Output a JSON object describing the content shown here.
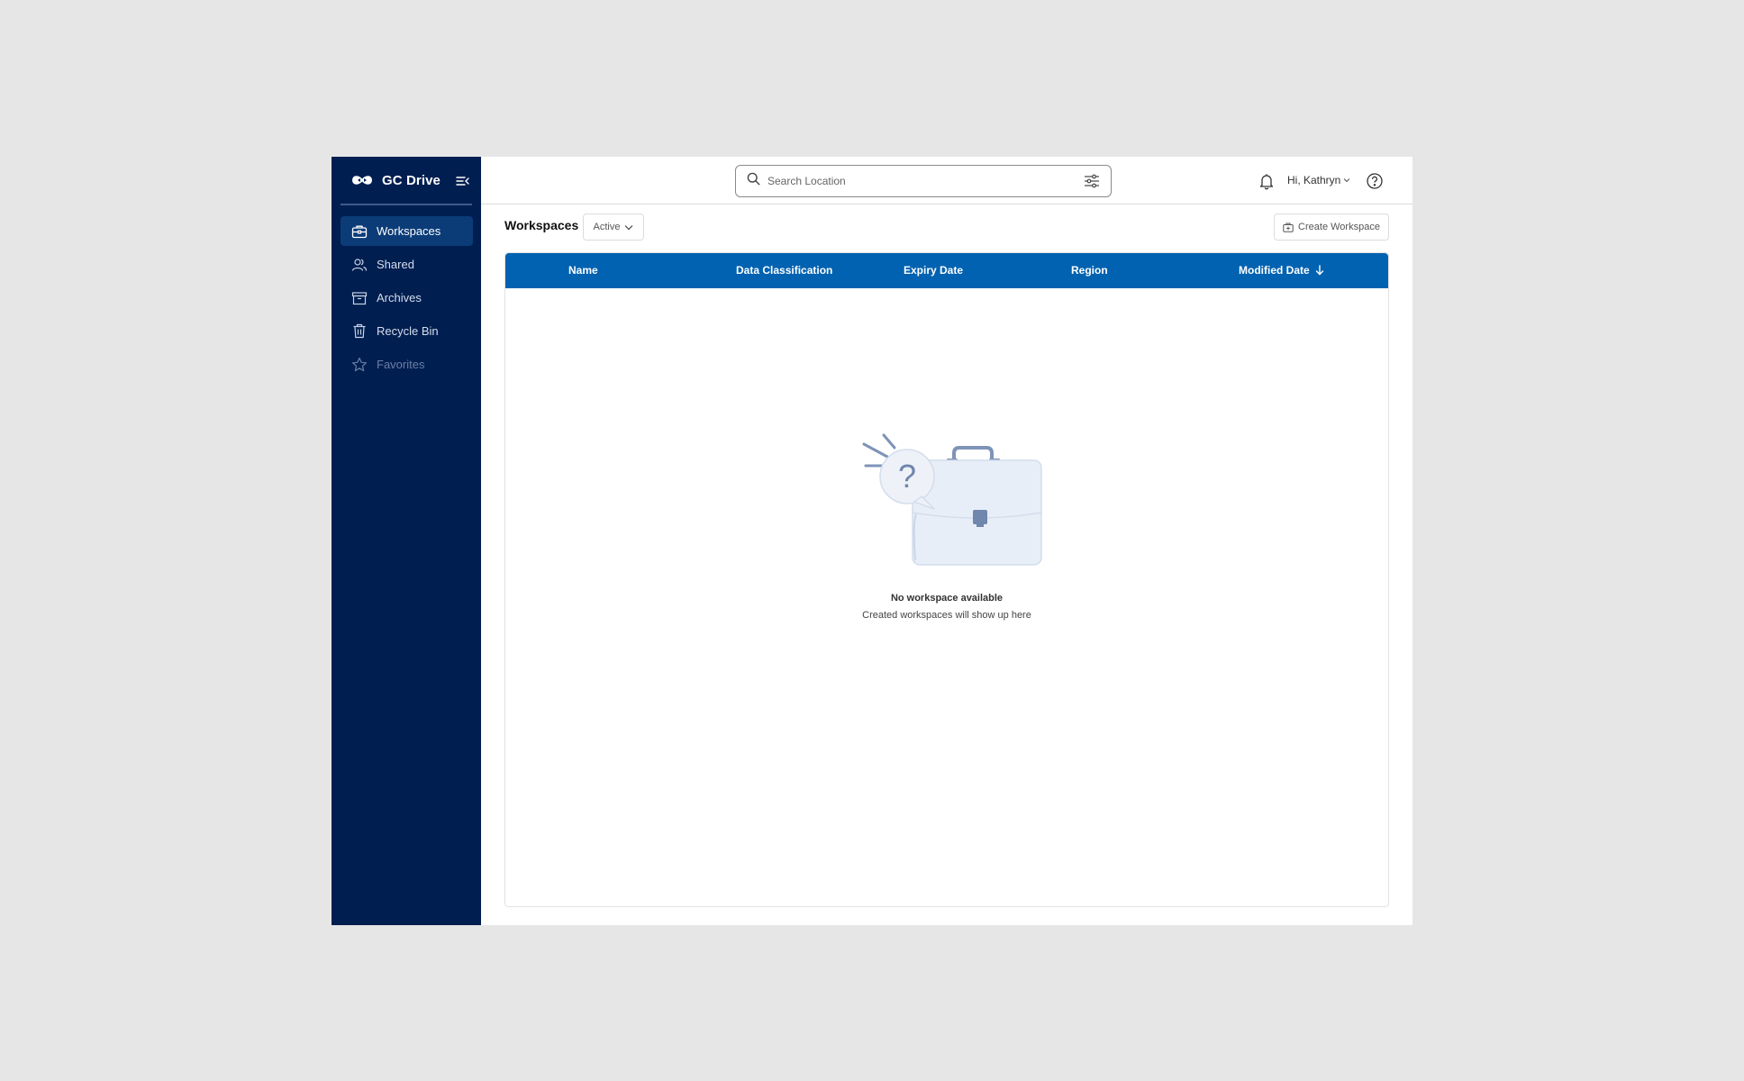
{
  "app": {
    "name": "GC Drive"
  },
  "sidebar": {
    "items": [
      {
        "label": "Workspaces",
        "icon": "briefcase-icon",
        "active": true
      },
      {
        "label": "Shared",
        "icon": "users-icon",
        "active": false
      },
      {
        "label": "Archives",
        "icon": "archive-icon",
        "active": false
      },
      {
        "label": "Recycle Bin",
        "icon": "trash-icon",
        "active": false
      },
      {
        "label": "Favorites",
        "icon": "star-icon",
        "active": false,
        "disabled": true
      }
    ]
  },
  "header": {
    "search_placeholder": "Search Location",
    "user_greeting": "Hi, Kathryn"
  },
  "toolbar": {
    "title": "Workspaces",
    "status_value": "Active",
    "create_label": "Create Workspace"
  },
  "table": {
    "columns": [
      "Name",
      "Data Classification",
      "Expiry Date",
      "Region",
      "Modified Date"
    ],
    "sorted_column": "Modified Date",
    "sort_direction": "descending",
    "rows": []
  },
  "empty_state": {
    "title": "No workspace available",
    "subtitle": "Created workspaces will show up here"
  },
  "colors": {
    "sidebar_bg": "#001e50",
    "sidebar_active": "#0b3c78",
    "table_header": "#0062b1",
    "page_bg": "#e6e6e6"
  }
}
